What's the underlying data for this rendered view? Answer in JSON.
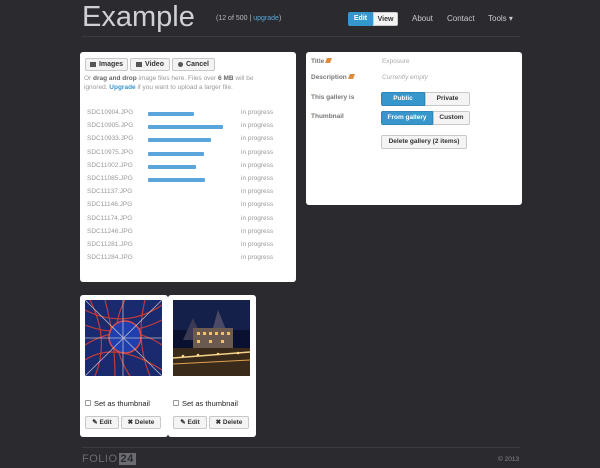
{
  "header": {
    "logo": "Example",
    "count_text": "(12 of 500 | ",
    "count_link": "upgrade",
    "count_close": ")",
    "mode_edit": "Edit",
    "mode_view": "View",
    "nav": [
      "About",
      "Contact",
      "Tools ▾"
    ]
  },
  "toolbar": {
    "images_label": "Images",
    "video_label": "Video",
    "cancel_label": "Cancel"
  },
  "help": {
    "or": "Or ",
    "drag": "drag and drop",
    "mid": " image files here. Files over ",
    "size": "6 MB",
    "mid2": " will be ignored. ",
    "upgrade": "Upgrade",
    "end": " if you want to upload a larger file."
  },
  "files": [
    {
      "name": "SDC10904.JPG",
      "status": "in progress",
      "progress": 0.48
    },
    {
      "name": "SDC10905.JPG",
      "status": "in progress",
      "progress": 0.79
    },
    {
      "name": "SDC10933.JPG",
      "status": "in progress",
      "progress": 0.66
    },
    {
      "name": "SDC10975.JPG",
      "status": "in progress",
      "progress": 0.59
    },
    {
      "name": "SDC11002.JPG",
      "status": "in progress",
      "progress": 0.5
    },
    {
      "name": "SDC11085.JPG",
      "status": "in progress",
      "progress": 0.6
    },
    {
      "name": "SDC11137.JPG",
      "status": "in progress",
      "progress": 0
    },
    {
      "name": "SDC11146.JPG",
      "status": "in progress",
      "progress": 0
    },
    {
      "name": "SDC11174.JPG",
      "status": "in progress",
      "progress": 0
    },
    {
      "name": "SDC11246.JPG",
      "status": "in progress",
      "progress": 0
    },
    {
      "name": "SDC11281.JPG",
      "status": "in progress",
      "progress": 0
    },
    {
      "name": "SDC11284.JPG",
      "status": "in progress",
      "progress": 0
    }
  ],
  "props": {
    "title_label": "Title",
    "title_value": "Exposure",
    "desc_label": "Description",
    "desc_value": "Currently empty",
    "visibility_label": "This gallery is",
    "public": "Public",
    "private": "Private",
    "thumb_label": "Thumbnail",
    "from_gallery": "From gallery",
    "custom": "Custom",
    "delete_gallery": "Delete gallery (2 items)"
  },
  "thumbs": [
    {
      "checkbox_label": "Set as thumbnail",
      "edit": "Edit",
      "delete": "Delete"
    },
    {
      "checkbox_label": "Set as thumbnail",
      "edit": "Edit",
      "delete": "Delete"
    }
  ],
  "footer": {
    "logo_text": "FOLIO",
    "logo_box": "24",
    "copyright": "© 2013"
  },
  "colors": {
    "accent": "#3796cc",
    "background": "#2a2a2f",
    "progress": "#5aa6dc"
  }
}
